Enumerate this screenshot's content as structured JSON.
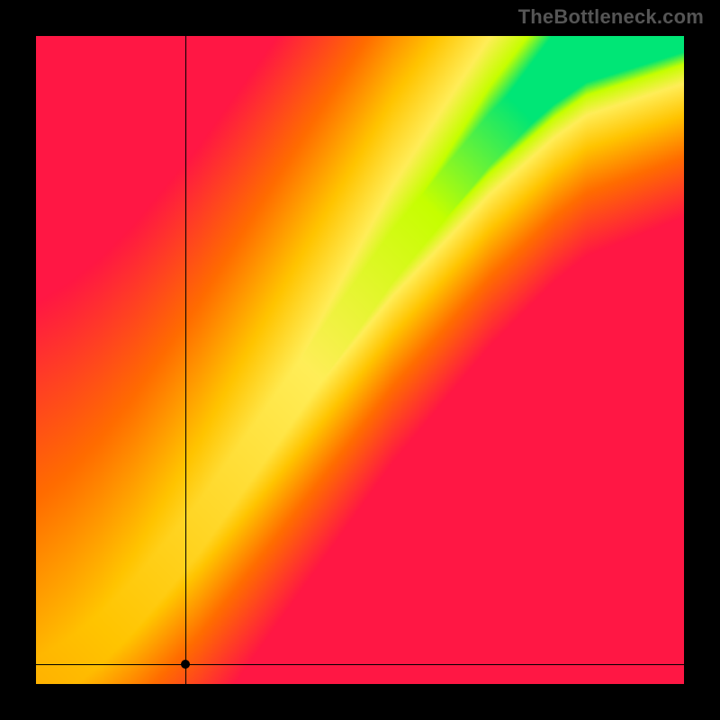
{
  "watermark": "TheBottleneck.com",
  "chart_data": {
    "type": "heatmap",
    "title": "",
    "xlabel": "",
    "ylabel": "",
    "xlim": [
      0,
      100
    ],
    "ylim": [
      0,
      100
    ],
    "grid": false,
    "legend": "none",
    "optimal_band": {
      "description": "Diagonal green band indicating balanced pairing; color gradient red→orange→yellow→green by distance from band",
      "curve_points": [
        {
          "x": 0,
          "y": 0
        },
        {
          "x": 5,
          "y": 3
        },
        {
          "x": 10,
          "y": 7
        },
        {
          "x": 15,
          "y": 12
        },
        {
          "x": 20,
          "y": 18
        },
        {
          "x": 25,
          "y": 24
        },
        {
          "x": 30,
          "y": 31
        },
        {
          "x": 35,
          "y": 38
        },
        {
          "x": 40,
          "y": 45
        },
        {
          "x": 45,
          "y": 52
        },
        {
          "x": 50,
          "y": 59
        },
        {
          "x": 55,
          "y": 66
        },
        {
          "x": 60,
          "y": 72
        },
        {
          "x": 65,
          "y": 78
        },
        {
          "x": 70,
          "y": 84
        },
        {
          "x": 75,
          "y": 89
        },
        {
          "x": 80,
          "y": 94
        },
        {
          "x": 85,
          "y": 98
        },
        {
          "x": 90,
          "y": 100
        }
      ],
      "band_half_width": 4
    },
    "marker": {
      "x": 23,
      "y": 3
    },
    "color_stops": [
      {
        "t": 0.0,
        "color": "#ff1744"
      },
      {
        "t": 0.35,
        "color": "#ff6d00"
      },
      {
        "t": 0.6,
        "color": "#ffc400"
      },
      {
        "t": 0.8,
        "color": "#ffee58"
      },
      {
        "t": 0.92,
        "color": "#c6ff00"
      },
      {
        "t": 1.0,
        "color": "#00e676"
      }
    ]
  },
  "plot": {
    "canvas_size": 720,
    "frame_offset": 40
  }
}
